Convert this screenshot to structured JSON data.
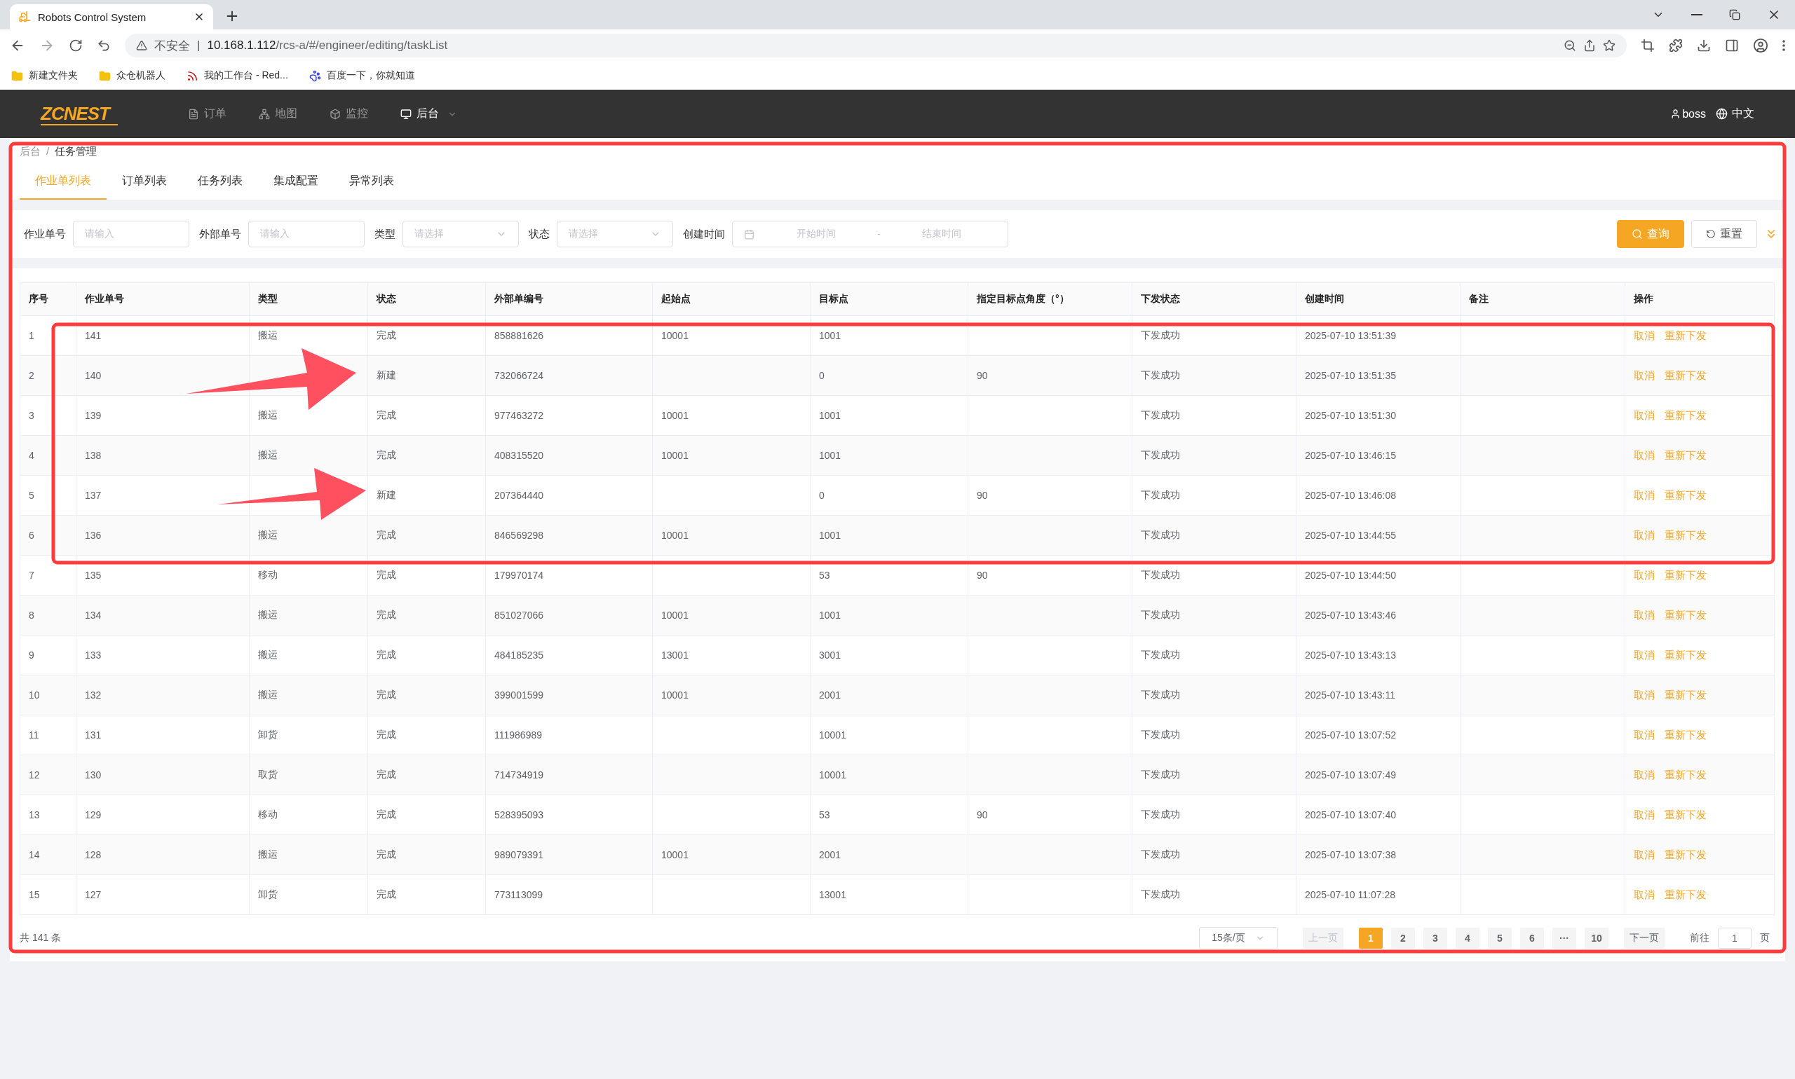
{
  "browser": {
    "tab_title": "Robots Control System",
    "security": "不安全",
    "security_separator": "|",
    "url_host": "10.168.1.112",
    "url_path": "/rcs-a/#/engineer/editing/taskList",
    "bookmarks": [
      {
        "kind": "folder",
        "label": "新建文件夹"
      },
      {
        "kind": "folder",
        "label": "众仓机器人"
      },
      {
        "kind": "redmine",
        "label": "我的工作台 - Red..."
      },
      {
        "kind": "baidu",
        "label": "百度一下，你就知道"
      }
    ]
  },
  "navbar": {
    "logo": "ZCNEST",
    "items": [
      {
        "kind": "order",
        "label": "订单",
        "selected": false
      },
      {
        "kind": "map",
        "label": "地图",
        "selected": false
      },
      {
        "kind": "monitor",
        "label": "监控",
        "selected": false
      },
      {
        "kind": "admin",
        "label": "后台",
        "selected": true
      }
    ],
    "user": "boss",
    "language": "中文"
  },
  "breadcrumb": [
    "后台",
    "任务管理"
  ],
  "breadcrumb_separator": "/",
  "tabs": [
    {
      "label": "作业单列表",
      "selected": true
    },
    {
      "label": "订单列表",
      "selected": false
    },
    {
      "label": "任务列表",
      "selected": false
    },
    {
      "label": "集成配置",
      "selected": false
    },
    {
      "label": "异常列表",
      "selected": false
    }
  ],
  "filters": [
    {
      "kind": "input",
      "label": "作业单号",
      "placeholder": "请输入"
    },
    {
      "kind": "input",
      "label": "外部单号",
      "placeholder": "请输入"
    },
    {
      "kind": "select",
      "label": "类型",
      "placeholder": "请选择"
    },
    {
      "kind": "select",
      "label": "状态",
      "placeholder": "请选择"
    },
    {
      "kind": "daterange",
      "label": "创建时间",
      "placeholder": "开始时间",
      "placeholder_end": "结束时间",
      "separator": "-"
    }
  ],
  "buttons": {
    "query": "查询",
    "reset": "重置"
  },
  "table": {
    "columns": [
      "序号",
      "作业单号",
      "类型",
      "状态",
      "外部单编号",
      "起始点",
      "目标点",
      "指定目标点角度（°）",
      "下发状态",
      "创建时间",
      "备注",
      "操作"
    ],
    "rows": [
      {
        "cells": [
          "1",
          "141",
          "搬运",
          "完成",
          "858881626",
          "10001",
          "1001",
          "",
          "下发成功",
          "2025-07-10 13:51:39",
          ""
        ],
        "actions": [
          "取消",
          "重新下发"
        ]
      },
      {
        "cells": [
          "2",
          "140",
          "",
          "新建",
          "732066724",
          "",
          "0",
          "90",
          "下发成功",
          "2025-07-10 13:51:35",
          ""
        ],
        "actions": [
          "取消",
          "重新下发"
        ]
      },
      {
        "cells": [
          "3",
          "139",
          "搬运",
          "完成",
          "977463272",
          "10001",
          "1001",
          "",
          "下发成功",
          "2025-07-10 13:51:30",
          ""
        ],
        "actions": [
          "取消",
          "重新下发"
        ]
      },
      {
        "cells": [
          "4",
          "138",
          "搬运",
          "完成",
          "408315520",
          "10001",
          "1001",
          "",
          "下发成功",
          "2025-07-10 13:46:15",
          ""
        ],
        "actions": [
          "取消",
          "重新下发"
        ]
      },
      {
        "cells": [
          "5",
          "137",
          "",
          "新建",
          "207364440",
          "",
          "0",
          "90",
          "下发成功",
          "2025-07-10 13:46:08",
          ""
        ],
        "actions": [
          "取消",
          "重新下发"
        ]
      },
      {
        "cells": [
          "6",
          "136",
          "搬运",
          "完成",
          "846569298",
          "10001",
          "1001",
          "",
          "下发成功",
          "2025-07-10 13:44:55",
          ""
        ],
        "actions": [
          "取消",
          "重新下发"
        ]
      },
      {
        "cells": [
          "7",
          "135",
          "移动",
          "完成",
          "179970174",
          "",
          "53",
          "90",
          "下发成功",
          "2025-07-10 13:44:50",
          ""
        ],
        "actions": [
          "取消",
          "重新下发"
        ]
      },
      {
        "cells": [
          "8",
          "134",
          "搬运",
          "完成",
          "851027066",
          "10001",
          "1001",
          "",
          "下发成功",
          "2025-07-10 13:43:46",
          ""
        ],
        "actions": [
          "取消",
          "重新下发"
        ]
      },
      {
        "cells": [
          "9",
          "133",
          "搬运",
          "完成",
          "484185235",
          "13001",
          "3001",
          "",
          "下发成功",
          "2025-07-10 13:43:13",
          ""
        ],
        "actions": [
          "取消",
          "重新下发"
        ]
      },
      {
        "cells": [
          "10",
          "132",
          "搬运",
          "完成",
          "399001599",
          "10001",
          "2001",
          "",
          "下发成功",
          "2025-07-10 13:43:11",
          ""
        ],
        "actions": [
          "取消",
          "重新下发"
        ]
      },
      {
        "cells": [
          "11",
          "131",
          "卸货",
          "完成",
          "111986989",
          "",
          "10001",
          "",
          "下发成功",
          "2025-07-10 13:07:52",
          ""
        ],
        "actions": [
          "取消",
          "重新下发"
        ]
      },
      {
        "cells": [
          "12",
          "130",
          "取货",
          "完成",
          "714734919",
          "",
          "10001",
          "",
          "下发成功",
          "2025-07-10 13:07:49",
          ""
        ],
        "actions": [
          "取消",
          "重新下发"
        ]
      },
      {
        "cells": [
          "13",
          "129",
          "移动",
          "完成",
          "528395093",
          "",
          "53",
          "90",
          "下发成功",
          "2025-07-10 13:07:40",
          ""
        ],
        "actions": [
          "取消",
          "重新下发"
        ]
      },
      {
        "cells": [
          "14",
          "128",
          "搬运",
          "完成",
          "989079391",
          "10001",
          "2001",
          "",
          "下发成功",
          "2025-07-10 13:07:38",
          ""
        ],
        "actions": [
          "取消",
          "重新下发"
        ]
      },
      {
        "cells": [
          "15",
          "127",
          "卸货",
          "完成",
          "773113099",
          "",
          "13001",
          "",
          "下发成功",
          "2025-07-10 11:07:28",
          ""
        ],
        "actions": [
          "取消",
          "重新下发"
        ]
      }
    ]
  },
  "pagination": {
    "total": "共 141 条",
    "page_size": "15条/页",
    "prev": {
      "label": "上一页",
      "disabled": true
    },
    "pages": [
      {
        "label": "1",
        "selected": true
      },
      {
        "label": "2",
        "selected": false
      },
      {
        "label": "3",
        "selected": false
      },
      {
        "label": "4",
        "selected": false
      },
      {
        "label": "5",
        "selected": false
      },
      {
        "label": "6",
        "selected": false
      },
      {
        "label": "···",
        "selected": false
      },
      {
        "label": "10",
        "selected": false
      }
    ],
    "next": {
      "label": "下一页",
      "disabled": false
    },
    "goto_label": "前往",
    "goto_value": "1",
    "goto_suffix": "页"
  }
}
